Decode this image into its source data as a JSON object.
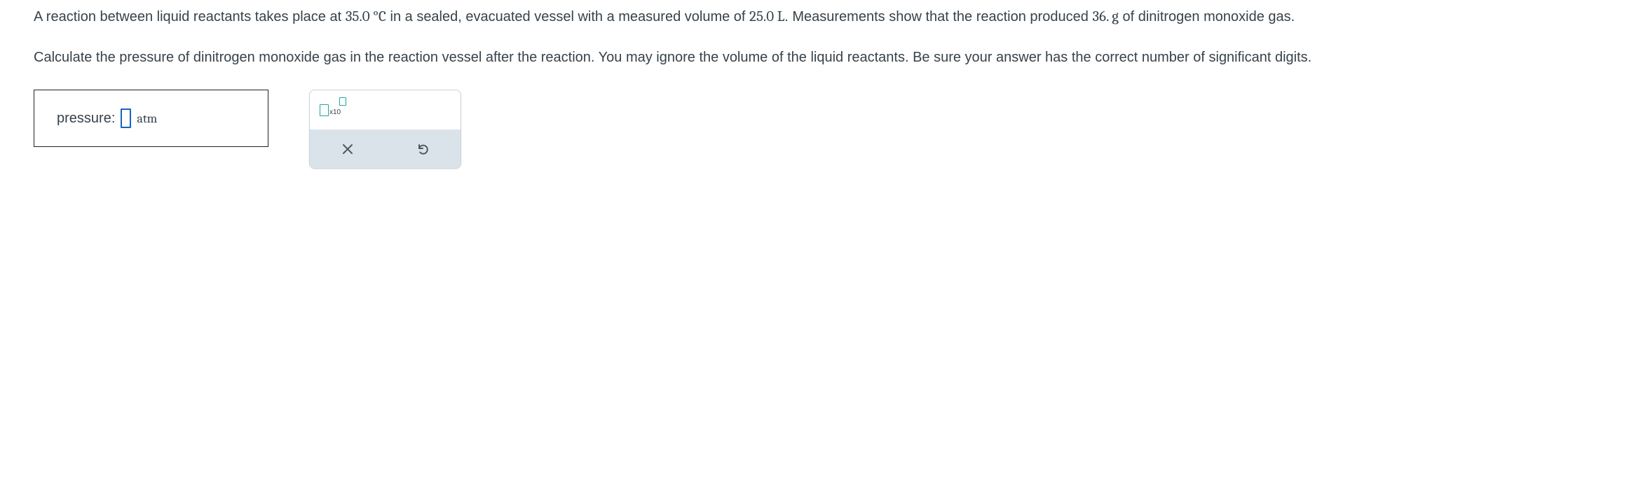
{
  "problem": {
    "para1_a": "A reaction between liquid reactants takes place at ",
    "temp": "35.0 °C",
    "para1_b": " in a sealed, evacuated vessel with a measured volume of ",
    "vol": "25.0 L",
    "para1_c": ". Measurements show that the reaction produced ",
    "mass": "36. g",
    "para1_d": " of dinitrogen monoxide gas.",
    "para2": "Calculate the pressure of dinitrogen monoxide gas in the reaction vessel after the reaction. You may ignore the volume of the liquid reactants. Be sure your answer has the correct number of significant digits."
  },
  "answer": {
    "label": "pressure:",
    "unit": "atm"
  },
  "toolbar": {
    "sci_label": "x10"
  }
}
